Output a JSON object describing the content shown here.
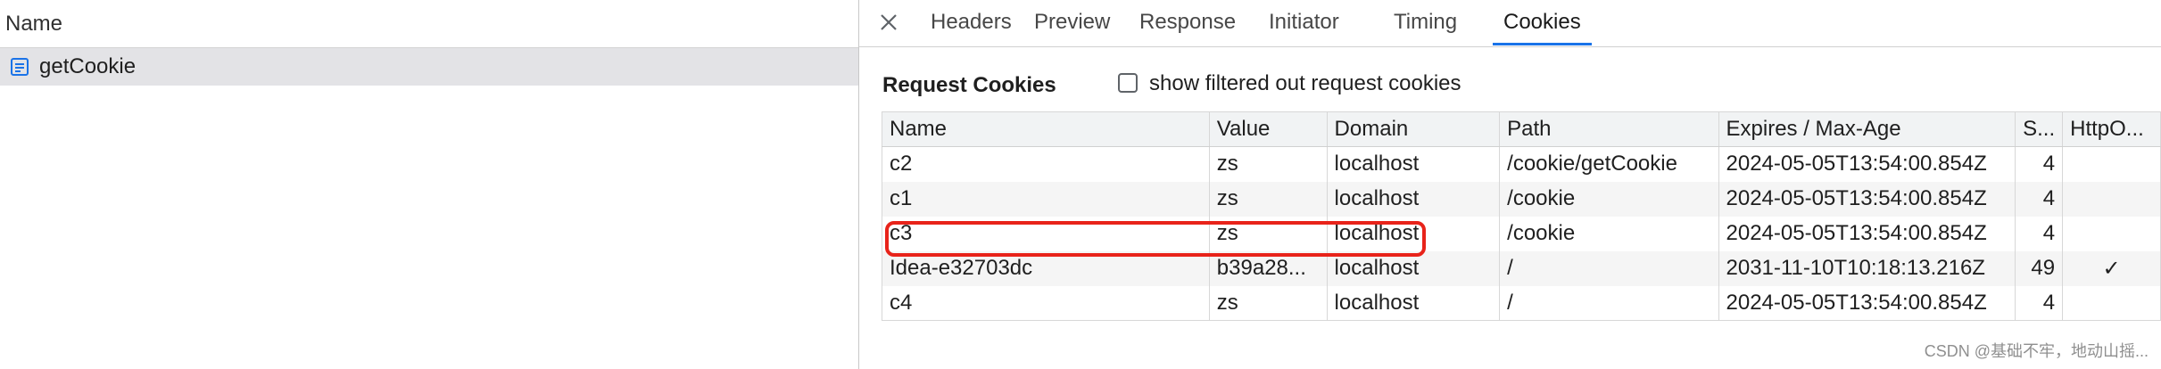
{
  "request_list": {
    "column_header": "Name",
    "items": [
      {
        "name": "getCookie",
        "selected": true,
        "icon": "document-icon"
      }
    ]
  },
  "details": {
    "tabs": [
      {
        "label": "Headers",
        "active": false
      },
      {
        "label": "Preview",
        "active": false
      },
      {
        "label": "Response",
        "active": false
      },
      {
        "label": "Initiator",
        "active": false
      },
      {
        "label": "Timing",
        "active": false
      },
      {
        "label": "Cookies",
        "active": true
      }
    ],
    "request_cookies": {
      "title": "Request Cookies",
      "filter_label": "show filtered out request cookies",
      "filter_checked": false,
      "columns": [
        "Name",
        "Value",
        "Domain",
        "Path",
        "Expires / Max-Age",
        "S...",
        "HttpO..."
      ],
      "rows": [
        {
          "name": "c2",
          "value": "zs",
          "domain": "localhost",
          "path": "/cookie/getCookie",
          "expires": "2024-05-05T13:54:00.854Z",
          "size": "4",
          "httponly": ""
        },
        {
          "name": "c1",
          "value": "zs",
          "domain": "localhost",
          "path": "/cookie",
          "expires": "2024-05-05T13:54:00.854Z",
          "size": "4",
          "httponly": ""
        },
        {
          "name": "c3",
          "value": "zs",
          "domain": "localhost",
          "path": "/cookie",
          "expires": "2024-05-05T13:54:00.854Z",
          "size": "4",
          "httponly": "",
          "highlighted": true
        },
        {
          "name": "Idea-e32703dc",
          "value": "b39a28...",
          "domain": "localhost",
          "path": "/",
          "expires": "2031-11-10T10:18:13.216Z",
          "size": "49",
          "httponly": "✓"
        },
        {
          "name": "c4",
          "value": "zs",
          "domain": "localhost",
          "path": "/",
          "expires": "2024-05-05T13:54:00.854Z",
          "size": "4",
          "httponly": ""
        }
      ]
    }
  },
  "watermark": "CSDN @基础不牢，地动山摇...",
  "colors": {
    "active_tab_underline": "#1a73e8",
    "highlight_border": "#e8231a",
    "selected_row": "#e3e3e6"
  }
}
